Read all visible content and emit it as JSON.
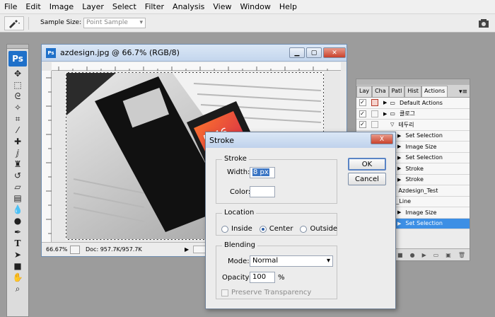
{
  "menubar": {
    "items": [
      "File",
      "Edit",
      "Image",
      "Layer",
      "Select",
      "Filter",
      "Analysis",
      "View",
      "Window",
      "Help"
    ]
  },
  "options_bar": {
    "tool_icon": "eyedropper-icon",
    "sample_size_label": "Sample Size:",
    "sample_size_value": "Point Sample"
  },
  "toolbox": {
    "logo": "Ps",
    "tools": [
      "move-icon",
      "marquee-icon",
      "lasso-icon",
      "magic-wand-icon",
      "crop-icon",
      "eyedropper-icon",
      "healing-icon",
      "brush-icon",
      "clone-stamp-icon",
      "history-brush-icon",
      "eraser-icon",
      "gradient-icon",
      "blur-icon",
      "dodge-icon",
      "pen-icon",
      "type-icon",
      "path-select-icon",
      "shape-icon",
      "hand-icon",
      "zoom-icon"
    ]
  },
  "document": {
    "title": "azdesign.jpg @ 66.7% (RGB/8)",
    "zoom": "66.67%",
    "doc_size": "Doc: 957.7K/957.7K"
  },
  "actions_panel": {
    "tabs": [
      "Lay",
      "Cha",
      "Patl",
      "Hist",
      "Actions"
    ],
    "rows": [
      {
        "text": "Default Actions",
        "check": "✓",
        "dialog_red": true,
        "level": 0,
        "kind": "set"
      },
      {
        "text": "클로그",
        "check": "✓",
        "dialog_red": false,
        "level": 0,
        "kind": "set"
      },
      {
        "text": "테두리",
        "check": "✓",
        "dialog_red": false,
        "level": 1,
        "kind": "action"
      },
      {
        "text": "Set Selection",
        "check": "✓",
        "dialog_red": false,
        "level": 2,
        "kind": "step"
      },
      {
        "text": "Image Size",
        "check": "✓",
        "dialog_red": false,
        "level": 2,
        "kind": "step"
      },
      {
        "text": "Set Selection",
        "check": "✓",
        "dialog_red": false,
        "level": 2,
        "kind": "step"
      },
      {
        "text": "Stroke",
        "check": "✓",
        "dialog_red": false,
        "level": 2,
        "kind": "step"
      },
      {
        "text": "Stroke",
        "check": "✓",
        "dialog_red": false,
        "level": 2,
        "kind": "step"
      },
      {
        "text": "Azdesign_Test",
        "check": "",
        "dialog_red": false,
        "level": 1,
        "kind": "action"
      },
      {
        "text": "Size_Line",
        "check": "",
        "dialog_red": false,
        "level": 0,
        "kind": "plain"
      },
      {
        "text": "Image Size",
        "check": "",
        "dialog_red": false,
        "level": 2,
        "kind": "step"
      },
      {
        "text": "Set Selection",
        "check": "",
        "dialog_red": false,
        "level": 2,
        "kind": "step",
        "selected": true
      }
    ]
  },
  "stroke_dialog": {
    "title": "Stroke",
    "stroke_group": "Stroke",
    "width_label": "Width:",
    "width_value": "8 px",
    "color_label": "Color:",
    "location_group": "Location",
    "location_options": [
      "Inside",
      "Center",
      "Outside"
    ],
    "location_selected": "Center",
    "blending_group": "Blending",
    "mode_label": "Mode:",
    "mode_value": "Normal",
    "opacity_label": "Opacity:",
    "opacity_value": "100",
    "opacity_unit": "%",
    "preserve_label": "Preserve Transparency",
    "ok_label": "OK",
    "cancel_label": "Cancel",
    "close_symbol": "X"
  }
}
